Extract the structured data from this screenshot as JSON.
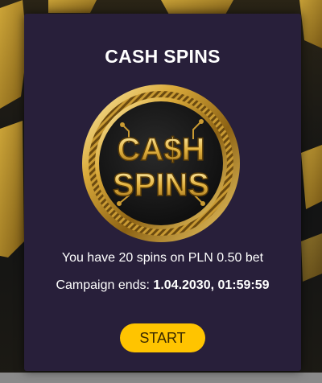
{
  "modal": {
    "title": "CASH SPINS",
    "logo": {
      "line1": "CA$H",
      "line2": "SPINS"
    },
    "spins_info": "You have 20 spins on PLN 0.50 bet",
    "campaign_label": "Campaign ends: ",
    "campaign_end": "1.04.2030, 01:59:59",
    "start_label": "START"
  },
  "colors": {
    "modal_bg": "#281f3a",
    "button_bg": "#ffc400",
    "gold": "#d9a93a",
    "backdrop": "#0f1012"
  },
  "icons": {
    "logo": "cash-spins-gold-coin-logo"
  }
}
